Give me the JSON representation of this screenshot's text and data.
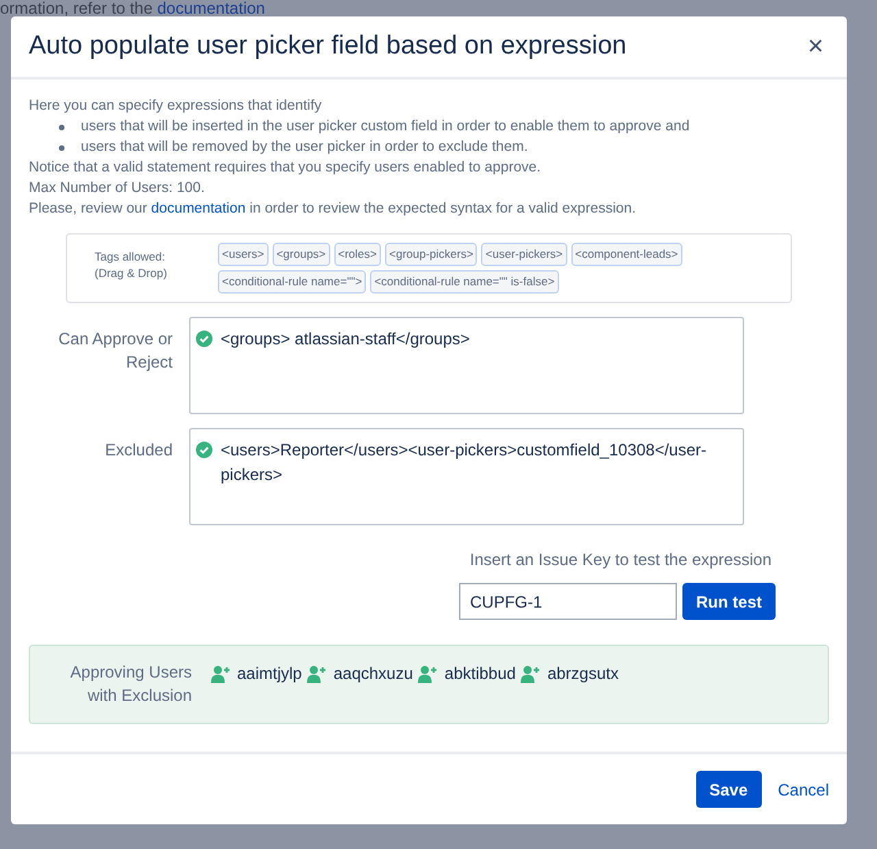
{
  "background": {
    "text": "ormation, refer to the ",
    "link": "documentation"
  },
  "dialog": {
    "title": "Auto populate user picker field based on expression",
    "close": "×"
  },
  "intro": {
    "lead": "Here you can specify expressions that identify",
    "bullets": [
      "users that will be inserted in the user picker custom field in order to enable them to approve and",
      "users that will be removed by the user picker in order to exclude them."
    ],
    "lines": [
      "Notice that a valid statement requires that you specify users enabled to approve.",
      "Max Number of Users: 100."
    ],
    "doc_before": "Please, review our ",
    "doc_link": "documentation",
    "doc_after": " in order to review the expected syntax for a valid expression."
  },
  "tags": {
    "label": [
      "Tags allowed:",
      "(Drag & Drop)"
    ],
    "items": [
      "<users>",
      "<groups>",
      "<roles>",
      "<group-pickers>",
      "<user-pickers>",
      "<component-leads>",
      "<conditional-rule name=\"\">",
      "<conditional-rule name=\"\" is-false>"
    ]
  },
  "fields": [
    {
      "label": "Can Approve or Reject",
      "value": "<groups> atlassian-staff</groups>",
      "valid": true
    },
    {
      "label": "Excluded",
      "value": "<users>Reporter</users><user-pickers>customfield_10308</user-pickers>",
      "valid": true
    }
  ],
  "test": {
    "label": "Insert an Issue Key to test the expression",
    "value": "CUPFG-1",
    "button": "Run test"
  },
  "result": {
    "label": "Approving Users with Exclusion",
    "users": [
      "aaimtjylp",
      "aaqchxuzu",
      "abktibbud",
      "abrzgsutx"
    ]
  },
  "footer": {
    "save": "Save",
    "cancel": "Cancel"
  }
}
